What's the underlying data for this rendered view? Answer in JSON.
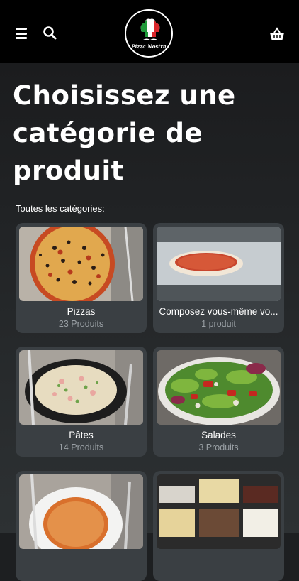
{
  "brand": {
    "logo_text": "Pizza Nostra"
  },
  "icons": {
    "menu": "menu-icon",
    "search": "search-icon",
    "cart": "basket-icon"
  },
  "main": {
    "title": "Choisissez une catégorie de produit",
    "subtitle": "Toutes les catégories:"
  },
  "categories": [
    {
      "name": "Pizzas",
      "count": "23 Produits",
      "image": "pizza-image"
    },
    {
      "name": "Composez vous-même vo...",
      "count": "1 produit",
      "image": "pizza-dough-image"
    },
    {
      "name": "Pâtes",
      "count": "14 Produits",
      "image": "pasta-image"
    },
    {
      "name": "Salades",
      "count": "3 Produits",
      "image": "salad-image"
    },
    {
      "name": "",
      "count": "",
      "image": "plate-image"
    },
    {
      "name": "",
      "count": "",
      "image": "toppings-image"
    }
  ],
  "colors": {
    "header_bg": "#000000",
    "card_bg": "#3a3f43",
    "count_text": "#9aa0a5"
  }
}
